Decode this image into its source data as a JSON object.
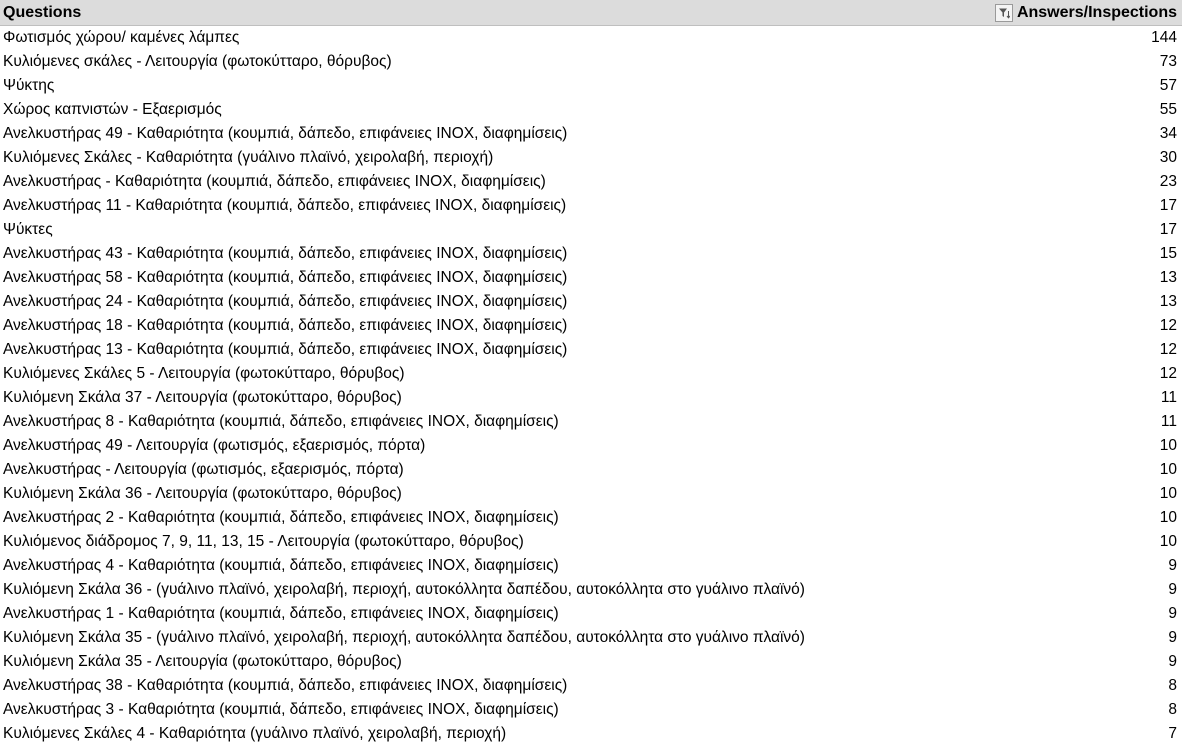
{
  "header": {
    "questions_label": "Questions",
    "answers_label": "Answers/Inspections",
    "filter_icon": "filter-sort-icon"
  },
  "rows": [
    {
      "question": "Φωτισμός χώρου/ καμένες λάμπες",
      "count": "144"
    },
    {
      "question": "Κυλιόμενες σκάλες - Λειτουργία (φωτοκύτταρο, θόρυβος)",
      "count": "73"
    },
    {
      "question": "Ψύκτης",
      "count": "57"
    },
    {
      "question": "Χώρος καπνιστών - Εξαερισμός",
      "count": "55"
    },
    {
      "question": "Ανελκυστήρας 49 - Καθαριότητα (κουμπιά, δάπεδο, επιφάνειες ΙΝΟΧ, διαφημίσεις)",
      "count": "34"
    },
    {
      "question": "Κυλιόμενες Σκάλες - Καθαριότητα (γυάλινο πλαϊνό, χειρολαβή, περιοχή)",
      "count": "30"
    },
    {
      "question": "Ανελκυστήρας - Καθαριότητα (κουμπιά, δάπεδο, επιφάνειες ΙΝΟΧ, διαφημίσεις)",
      "count": "23"
    },
    {
      "question": "Ανελκυστήρας 11 - Καθαριότητα (κουμπιά, δάπεδο, επιφάνειες ΙΝΟΧ, διαφημίσεις)",
      "count": "17"
    },
    {
      "question": "Ψύκτες",
      "count": "17"
    },
    {
      "question": "Ανελκυστήρας 43 - Καθαριότητα (κουμπιά, δάπεδο, επιφάνειες ΙΝΟΧ, διαφημίσεις)",
      "count": "15"
    },
    {
      "question": "Ανελκυστήρας 58 - Καθαριότητα (κουμπιά, δάπεδο, επιφάνειες ΙΝΟΧ, διαφημίσεις)",
      "count": "13"
    },
    {
      "question": "Ανελκυστήρας 24 - Καθαριότητα (κουμπιά, δάπεδο, επιφάνειες ΙΝΟΧ, διαφημίσεις)",
      "count": "13"
    },
    {
      "question": "Ανελκυστήρας 18 - Καθαριότητα (κουμπιά, δάπεδο, επιφάνειες ΙΝΟΧ, διαφημίσεις)",
      "count": "12"
    },
    {
      "question": "Ανελκυστήρας 13 - Καθαριότητα (κουμπιά, δάπεδο, επιφάνειες ΙΝΟΧ, διαφημίσεις)",
      "count": "12"
    },
    {
      "question": "Κυλιόμενες Σκάλες 5 - Λειτουργία (φωτοκύτταρο, θόρυβος)",
      "count": "12"
    },
    {
      "question": "Κυλιόμενη Σκάλα 37 - Λειτουργία (φωτοκύτταρο, θόρυβος)",
      "count": "11"
    },
    {
      "question": "Ανελκυστήρας 8 - Καθαριότητα (κουμπιά, δάπεδο, επιφάνειες ΙΝΟΧ, διαφημίσεις)",
      "count": "11"
    },
    {
      "question": "Ανελκυστήρας 49 - Λειτουργία (φωτισμός, εξαερισμός, πόρτα)",
      "count": "10"
    },
    {
      "question": "Ανελκυστήρας - Λειτουργία (φωτισμός, εξαερισμός, πόρτα)",
      "count": "10"
    },
    {
      "question": "Κυλιόμενη Σκάλα 36 - Λειτουργία (φωτοκύτταρο, θόρυβος)",
      "count": "10"
    },
    {
      "question": "Ανελκυστήρας 2 - Καθαριότητα (κουμπιά, δάπεδο, επιφάνειες ΙΝΟΧ, διαφημίσεις)",
      "count": "10"
    },
    {
      "question": "Κυλιόμενος διάδρομος 7, 9, 11, 13, 15 - Λειτουργία (φωτοκύτταρο, θόρυβος)",
      "count": "10"
    },
    {
      "question": "Ανελκυστήρας 4 - Καθαριότητα (κουμπιά, δάπεδο, επιφάνειες ΙΝΟΧ, διαφημίσεις)",
      "count": "9"
    },
    {
      "question": "Κυλιόμενη Σκάλα 36 - (γυάλινο πλαϊνό, χειρολαβή, περιοχή, αυτοκόλλητα δαπέδου, αυτοκόλλητα στο γυάλινο πλαϊνό)",
      "count": "9"
    },
    {
      "question": "Ανελκυστήρας  1 - Καθαριότητα (κουμπιά, δάπεδο, επιφάνειες ΙΝΟΧ, διαφημίσεις)",
      "count": "9"
    },
    {
      "question": "Κυλιόμενη Σκάλα 35 - (γυάλινο πλαϊνό, χειρολαβή, περιοχή, αυτοκόλλητα δαπέδου, αυτοκόλλητα στο γυάλινο πλαϊνό)",
      "count": "9"
    },
    {
      "question": "Κυλιόμενη Σκάλα 35 - Λειτουργία (φωτοκύτταρο, θόρυβος)",
      "count": "9"
    },
    {
      "question": "Ανελκυστήρας 38 - Καθαριότητα (κουμπιά, δάπεδο, επιφάνειες ΙΝΟΧ, διαφημίσεις)",
      "count": "8"
    },
    {
      "question": "Ανελκυστήρας 3 - Καθαριότητα (κουμπιά, δάπεδο, επιφάνειες ΙΝΟΧ, διαφημίσεις)",
      "count": "8"
    },
    {
      "question": "Κυλιόμενες Σκάλες 4 - Καθαριότητα (γυάλινο πλαϊνό, χειρολαβή, περιοχή)",
      "count": "7"
    }
  ]
}
